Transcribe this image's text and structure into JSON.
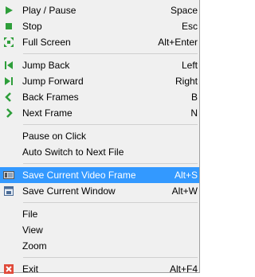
{
  "menu": {
    "items": [
      {
        "label": "Play / Pause",
        "shortcut": "Space",
        "icon": "play-icon"
      },
      {
        "label": "Stop",
        "shortcut": "Esc",
        "icon": "stop-icon"
      },
      {
        "label": "Full Screen",
        "shortcut": "Alt+Enter",
        "icon": "fullscreen-icon"
      },
      {
        "label": "Jump Back",
        "shortcut": "Left",
        "icon": "jump-back-icon"
      },
      {
        "label": "Jump Forward",
        "shortcut": "Right",
        "icon": "jump-forward-icon"
      },
      {
        "label": "Back Frames",
        "shortcut": "B",
        "icon": "chevron-left-icon"
      },
      {
        "label": "Next Frame",
        "shortcut": "N",
        "icon": "chevron-right-icon"
      },
      {
        "label": "Pause on Click",
        "shortcut": ""
      },
      {
        "label": "Auto Switch to Next File",
        "shortcut": ""
      },
      {
        "label": "Save Current Video Frame",
        "shortcut": "Alt+S",
        "icon": "film-frame-icon"
      },
      {
        "label": "Save Current Window",
        "shortcut": "Alt+W",
        "icon": "save-window-icon"
      },
      {
        "label": "File",
        "shortcut": ""
      },
      {
        "label": "View",
        "shortcut": ""
      },
      {
        "label": "Zoom",
        "shortcut": ""
      },
      {
        "label": "Exit",
        "shortcut": "Alt+F4",
        "icon": "exit-icon"
      }
    ]
  },
  "colors": {
    "highlight": "#3399ff",
    "play_green": "#2e9e3a",
    "exit_red": "#e04a3a"
  }
}
